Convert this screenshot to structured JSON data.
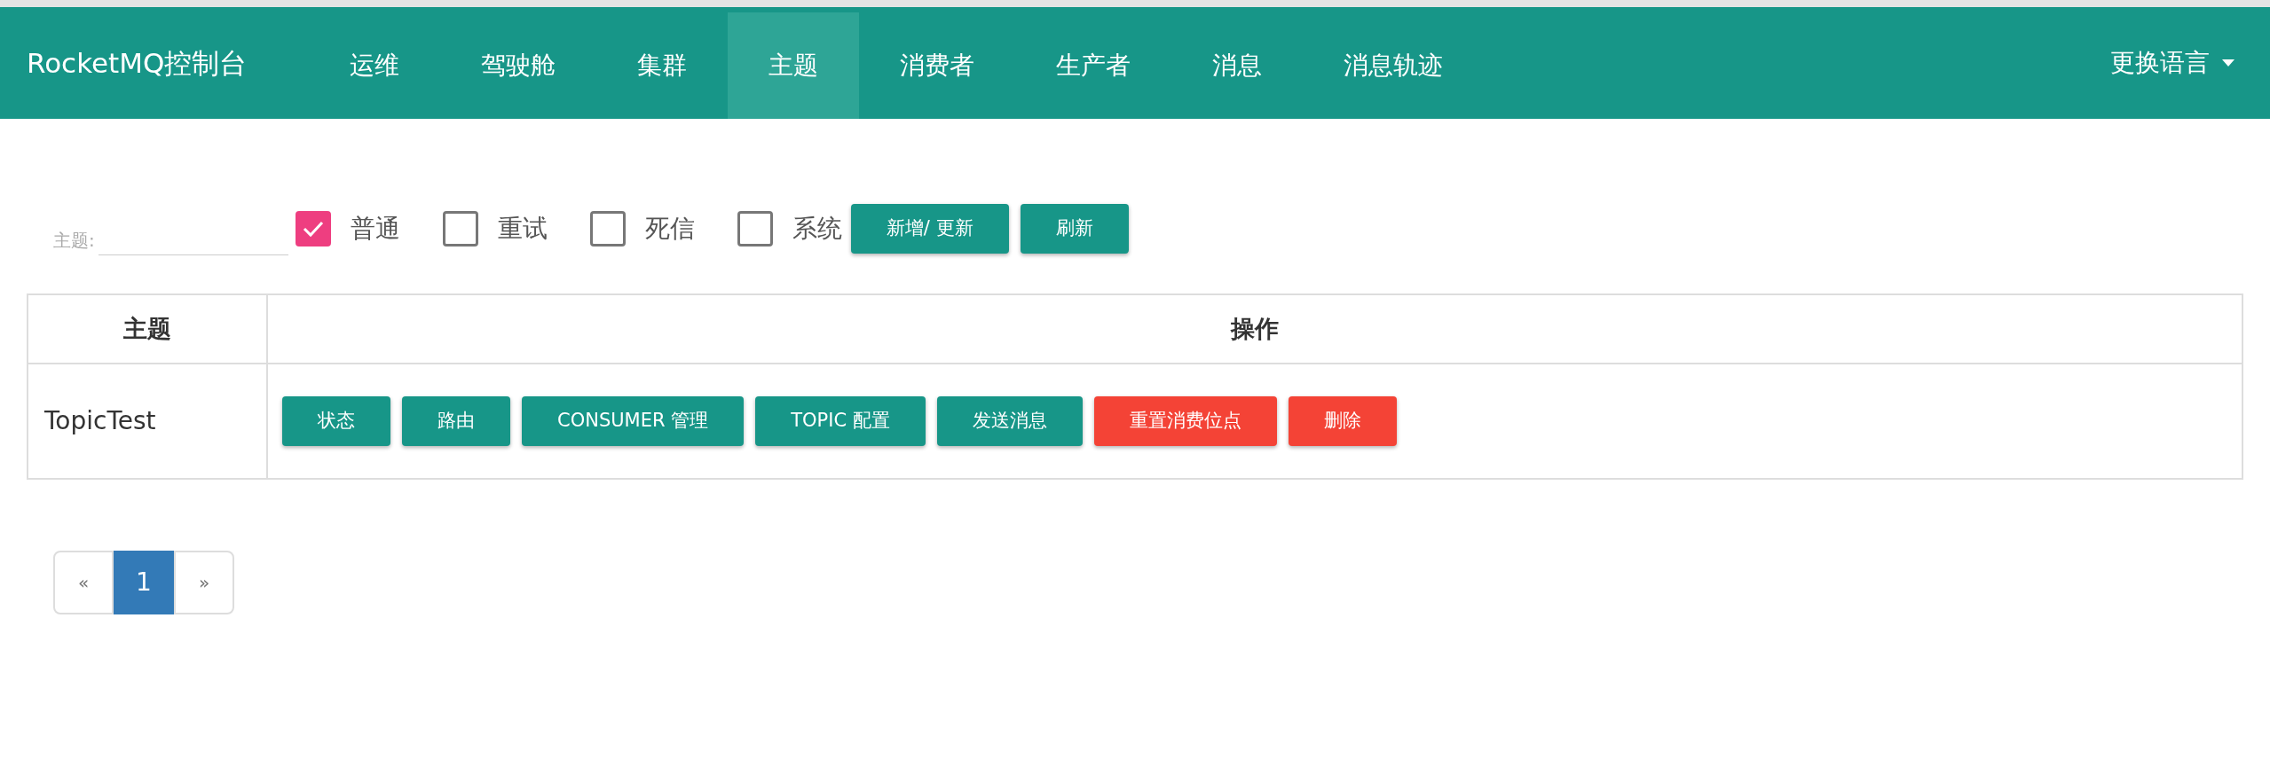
{
  "navbar": {
    "brand": "RocketMQ控制台",
    "items": [
      {
        "label": "运维",
        "selected": false
      },
      {
        "label": "驾驶舱",
        "selected": false
      },
      {
        "label": "集群",
        "selected": false
      },
      {
        "label": "主题",
        "selected": true
      },
      {
        "label": "消费者",
        "selected": false
      },
      {
        "label": "生产者",
        "selected": false
      },
      {
        "label": "消息",
        "selected": false
      },
      {
        "label": "消息轨迹",
        "selected": false
      }
    ],
    "language": "更换语言"
  },
  "filter": {
    "label": "主题:",
    "checkboxes": [
      {
        "label": "普通",
        "checked": true
      },
      {
        "label": "重试",
        "checked": false
      },
      {
        "label": "死信",
        "checked": false
      },
      {
        "label": "系统",
        "checked": false
      }
    ],
    "buttons": [
      "新增/ 更新",
      "刷新"
    ]
  },
  "table": {
    "columns": [
      "主题",
      "操作"
    ],
    "rows": [
      {
        "topic": "TopicTest",
        "actions": [
          {
            "label": "状态",
            "kind": "primary"
          },
          {
            "label": "路由",
            "kind": "primary"
          },
          {
            "label": "CONSUMER 管理",
            "kind": "primary"
          },
          {
            "label": "TOPIC 配置",
            "kind": "primary"
          },
          {
            "label": "发送消息",
            "kind": "primary"
          },
          {
            "label": "重置消费位点",
            "kind": "danger"
          },
          {
            "label": "删除",
            "kind": "danger"
          }
        ]
      }
    ]
  },
  "pagination": [
    {
      "label": "«",
      "selected": false
    },
    {
      "label": "1",
      "selected": true
    },
    {
      "label": "»",
      "selected": false
    }
  ]
}
